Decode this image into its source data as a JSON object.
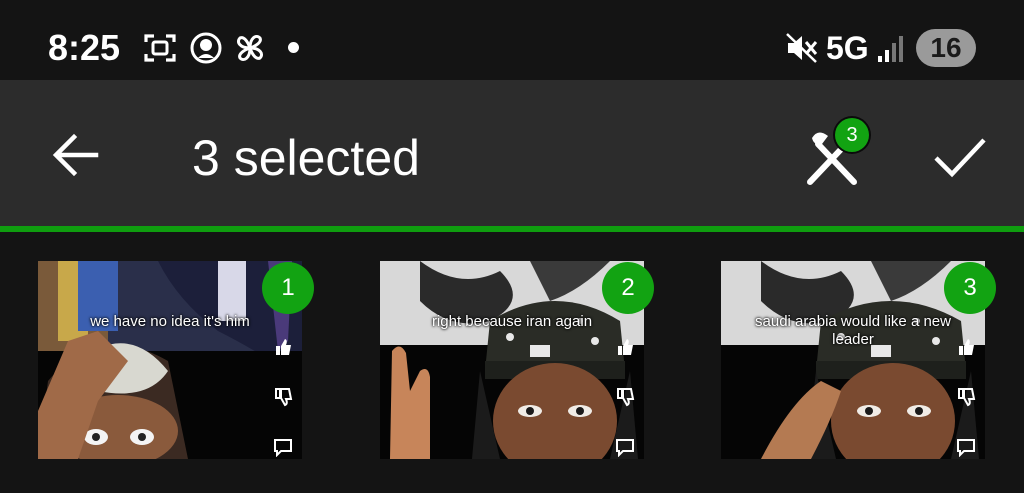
{
  "status_bar": {
    "time": "8:25",
    "network": "5G",
    "battery": "16",
    "icons": [
      "screenshot-icon",
      "app-notification-icon",
      "pinwheel-icon",
      "notification-dot-icon",
      "mute-icon",
      "signal-icon"
    ]
  },
  "app_bar": {
    "title": "3 selected",
    "tool_badge_count": "3",
    "back_icon": "arrow-back-icon",
    "tool_icon": "brush-tools-icon",
    "done_icon": "check-icon"
  },
  "colors": {
    "accent_green": "#12a312",
    "app_bar_bg": "#2c2c2c",
    "background": "#141414"
  },
  "thumbnails": [
    {
      "order": "1",
      "caption": "we have no idea it's him"
    },
    {
      "order": "2",
      "caption": "right because iran again"
    },
    {
      "order": "3",
      "caption": "saudi arabia would like a new leader"
    }
  ]
}
